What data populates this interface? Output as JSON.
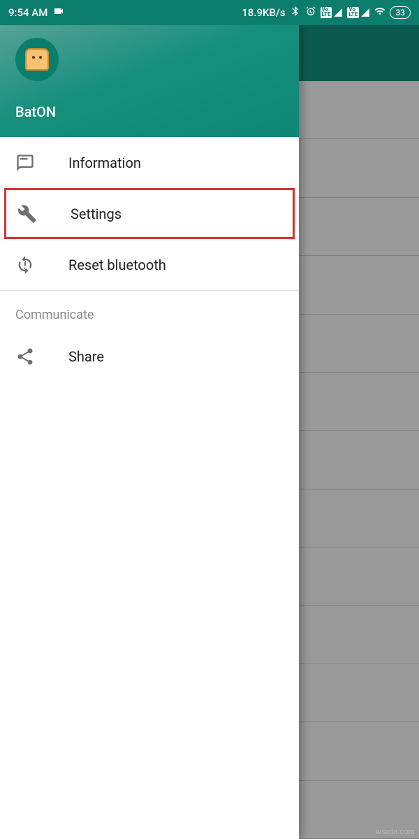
{
  "status_bar": {
    "time": "9:54 AM",
    "speed": "18.9KB/s",
    "battery_level": "33"
  },
  "drawer": {
    "app_name": "BatON",
    "menu": {
      "information": "Information",
      "settings": "Settings",
      "reset_bluetooth": "Reset bluetooth"
    },
    "section_header": "Communicate",
    "share": "Share"
  },
  "watermark": "wsxdn.com"
}
